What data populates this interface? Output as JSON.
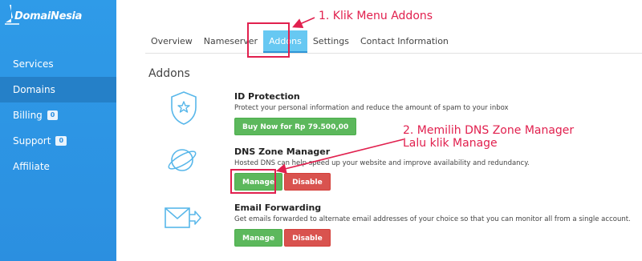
{
  "brand": {
    "name": "DomaiNesia"
  },
  "sidebar": {
    "items": [
      {
        "label": "Services"
      },
      {
        "label": "Domains"
      },
      {
        "label": "Billing",
        "badge": "0"
      },
      {
        "label": "Support",
        "badge": "0"
      },
      {
        "label": "Affiliate"
      }
    ]
  },
  "tabs": [
    {
      "label": "Overview"
    },
    {
      "label": "Nameserver"
    },
    {
      "label": "Addons"
    },
    {
      "label": "Settings"
    },
    {
      "label": "Contact Information"
    }
  ],
  "section": {
    "title": "Addons"
  },
  "addons": [
    {
      "name": "ID Protection",
      "desc": "Protect your personal information and reduce the amount of spam to your inbox",
      "buy_label": "Buy Now for Rp 79.500,00",
      "icon": "shield-star-icon"
    },
    {
      "name": "DNS Zone Manager",
      "desc": "Hosted DNS can help speed up your website and improve availability and redundancy.",
      "manage_label": "Manage",
      "disable_label": "Disable",
      "icon": "planet-icon"
    },
    {
      "name": "Email Forwarding",
      "desc": "Get emails forwarded to alternate email addresses of your choice so that you can monitor all from a single account.",
      "manage_label": "Manage",
      "disable_label": "Disable",
      "icon": "envelope-forward-icon"
    }
  ],
  "annotations": {
    "step1": "1. Klik Menu Addons",
    "step2_line1": "2. Memilih DNS Zone Manager",
    "step2_line2": "Lalu klik Manage"
  },
  "colors": {
    "sidebar": "#2b8fe0",
    "active_tab": "#67c8f2",
    "annotation": "#e1204e",
    "green": "#5cb85c",
    "red": "#d9534f"
  }
}
